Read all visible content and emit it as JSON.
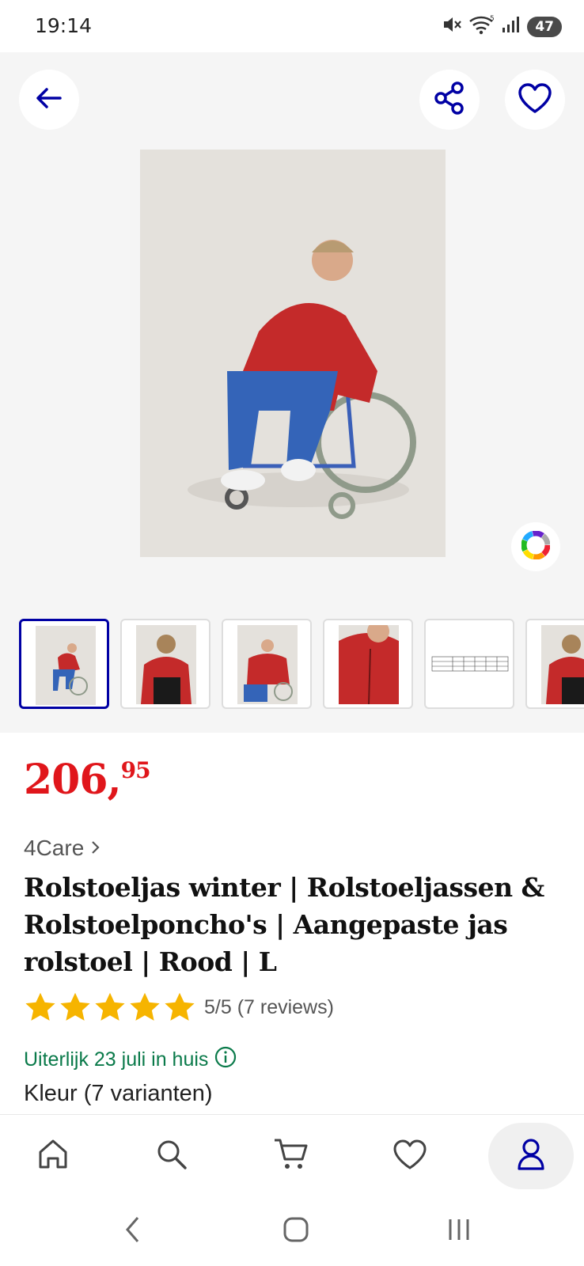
{
  "status_bar": {
    "time": "19:14",
    "battery": "47",
    "signal_label": "5"
  },
  "gallery": {
    "back_icon": "arrow-left-icon",
    "share_icon": "share-icon",
    "favorite_icon": "heart-icon",
    "color_wheel_icon": "color-wheel-icon",
    "thumbnail_count": 6,
    "active_thumbnail": 0
  },
  "product": {
    "price_whole": "206,",
    "price_cents": "95",
    "brand": "4Care",
    "title": "Rolstoeljas winter | Rolstoeljassen & Rolstoelponcho's | Aangepaste jas rolstoel | Rood | L",
    "rating_stars": 5,
    "rating_text": "5/5 (7 reviews)",
    "delivery": "Uiterlijk 23 juli in huis",
    "variant": "Kleur (7 varianten)"
  },
  "bottom_nav": {
    "items": [
      "home-icon",
      "search-icon",
      "cart-icon",
      "heart-icon",
      "account-icon"
    ],
    "active": "account-icon"
  },
  "colors": {
    "accent_blue": "#0000a4",
    "price_red": "#e0161b",
    "delivery_green": "#0a7a4a",
    "star_yellow": "#f6b400"
  }
}
